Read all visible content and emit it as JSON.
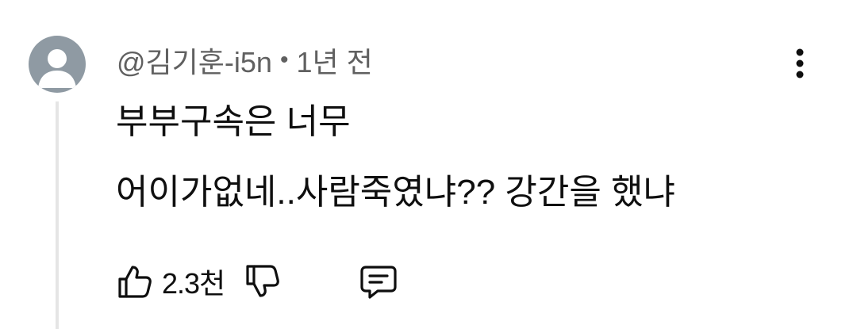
{
  "comment": {
    "author": "@김기훈-i5n",
    "separator": "•",
    "timestamp": "1년 전",
    "text_lines": [
      "부부구속은 너무",
      "어이가없네..사람죽였냐?? 강간을 했냐"
    ],
    "like_count": "2.3천"
  },
  "icons": {
    "avatar": "default-avatar",
    "more": "vertical-ellipsis-icon",
    "like": "thumbs-up-icon",
    "dislike": "thumbs-down-icon",
    "reply": "comment-reply-icon"
  },
  "colors": {
    "avatar_bg": "#8f9aa3",
    "meta_text": "#606060",
    "body_text": "#0f0f0f",
    "thread_line": "#e5e5e5"
  }
}
